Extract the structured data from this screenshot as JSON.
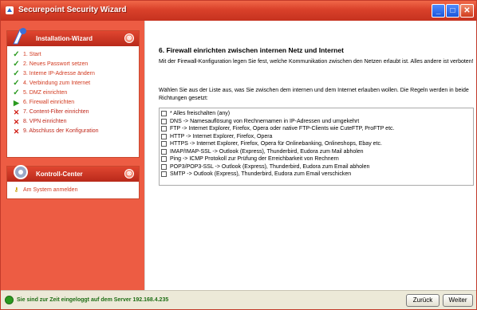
{
  "window": {
    "title": "Securepoint Security Wizard",
    "minimize": "_",
    "maximize": "□",
    "close": "✕"
  },
  "sidebar": {
    "wizard_panel": {
      "title": "Installation-Wizard",
      "collapse": "⊗",
      "steps": [
        {
          "label": "1. Start",
          "state": "done"
        },
        {
          "label": "2. Neues Passwort setzen",
          "state": "done"
        },
        {
          "label": "3. Interne IP-Adresse ändern",
          "state": "done"
        },
        {
          "label": "4. Verbindung zum Internet",
          "state": "done"
        },
        {
          "label": "5. DMZ einrichten",
          "state": "done"
        },
        {
          "label": "6. Firewall einrichten",
          "state": "current"
        },
        {
          "label": "7. Content-Filter einrichten",
          "state": "todo"
        },
        {
          "label": "8. VPN einrichten",
          "state": "todo"
        },
        {
          "label": "9. Abschluss der Konfiguration",
          "state": "todo"
        }
      ]
    },
    "control_panel": {
      "title": "Kontroll-Center",
      "collapse": "⊗",
      "items": [
        {
          "label": "Am System anmelden"
        }
      ]
    }
  },
  "main": {
    "heading": "6.   Firewall einrichten zwischen internen Netz und Internet",
    "paragraph1": "Mit der Firewall-Konfiguration legen Sie fest, welche Kommunikation zwischen den Netzen erlaubt ist. Alles andere ist verboten!",
    "paragraph2": "Wählen Sie aus der Liste aus, was Sie zwischen dem internen und dem Internet erlauben wollen. Die Regeln werden in beide Richtungen gesetzt:",
    "rules": [
      {
        "label": "* Alles freischalten (any)",
        "checked": false
      },
      {
        "label": "DNS -> Namesauflösung von Rechnernamen in IP-Adressen und umgekehrt",
        "checked": false
      },
      {
        "label": "FTP -> Internet Explorer, Firefox, Opera oder native FTP-Clients wie CuteFTP, ProFTP etc.",
        "checked": false
      },
      {
        "label": "HTTP -> Internet Explorer, Firefox, Opera",
        "checked": false
      },
      {
        "label": "HTTPS -> Internet Explorer, Firefox, Opera für Onlinebanking, Onlineshops, Ebay etc.",
        "checked": false
      },
      {
        "label": "IMAP/IMAP-SSL -> Outlook (Express), Thunderbird, Eudora zum Mail abholen",
        "checked": false
      },
      {
        "label": "Ping -> ICMP Protokoll zur Prüfung der Erreichbarkeit von Rechnern",
        "checked": false
      },
      {
        "label": "POP3/POP3-SSL -> Outlook (Express), Thunderbird, Eudora zum Email abholen",
        "checked": false
      },
      {
        "label": "SMTP -> Outlook (Express), Thunderbird, Eudora zum Email verschicken",
        "checked": false
      }
    ]
  },
  "statusbar": {
    "text": "Sie sind zur Zeit eingeloggt auf dem Server 192.168.4.235",
    "back_label": "Zurück",
    "next_label": "Weiter"
  },
  "colors": {
    "sidebar_bg": "#ed5c43",
    "panel_header": "#c3321f",
    "done_mark": "#2a9a1f",
    "todo_mark": "#d01a10"
  }
}
